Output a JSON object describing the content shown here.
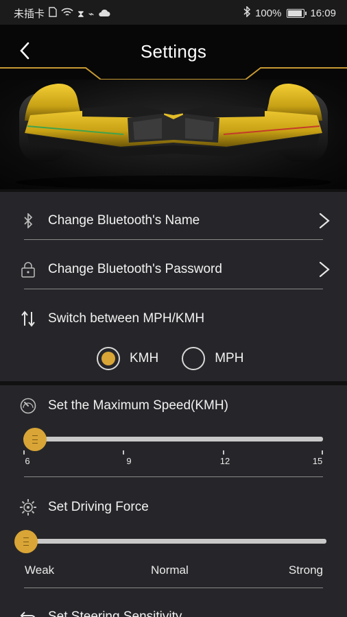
{
  "status_bar": {
    "carrier": "未插卡",
    "battery_percent": "100%",
    "battery_level": 1.0,
    "time": "16:09",
    "icons": [
      "sim-icon",
      "wifi-icon",
      "hourglass-icon",
      "usb-icon",
      "cloud-icon",
      "bluetooth-icon",
      "battery-icon"
    ]
  },
  "header": {
    "title": "Settings",
    "back_icon": "chevron-left-icon",
    "accent_color": "#c89a33"
  },
  "hero": {
    "image": "yellow hoverboard",
    "color": "#e2b51e"
  },
  "settings": {
    "bluetooth_name": {
      "label": "Change Bluetooth's Name",
      "icon": "bluetooth-icon"
    },
    "bluetooth_password": {
      "label": "Change Bluetooth's Password",
      "icon": "lock-icon"
    },
    "units": {
      "label": "Switch between MPH/KMH",
      "icon": "switch-arrows-icon",
      "options": [
        "KMH",
        "MPH"
      ],
      "selected": "KMH"
    },
    "max_speed": {
      "label": "Set the Maximum Speed(KMH)",
      "icon": "speedometer-icon",
      "min": 6,
      "max": 15,
      "value": 6,
      "ticks": [
        "6",
        "9",
        "12",
        "15"
      ]
    },
    "driving_force": {
      "label": "Set Driving Force",
      "icon": "gear-icon",
      "value": 0,
      "levels": [
        "Weak",
        "Normal",
        "Strong"
      ]
    },
    "steering": {
      "label": "Set Steering Sensitivity",
      "icon": "steering-arrow-icon"
    }
  },
  "colors": {
    "accent": "#d9a536",
    "panel": "#26262a",
    "background": "#111111"
  }
}
